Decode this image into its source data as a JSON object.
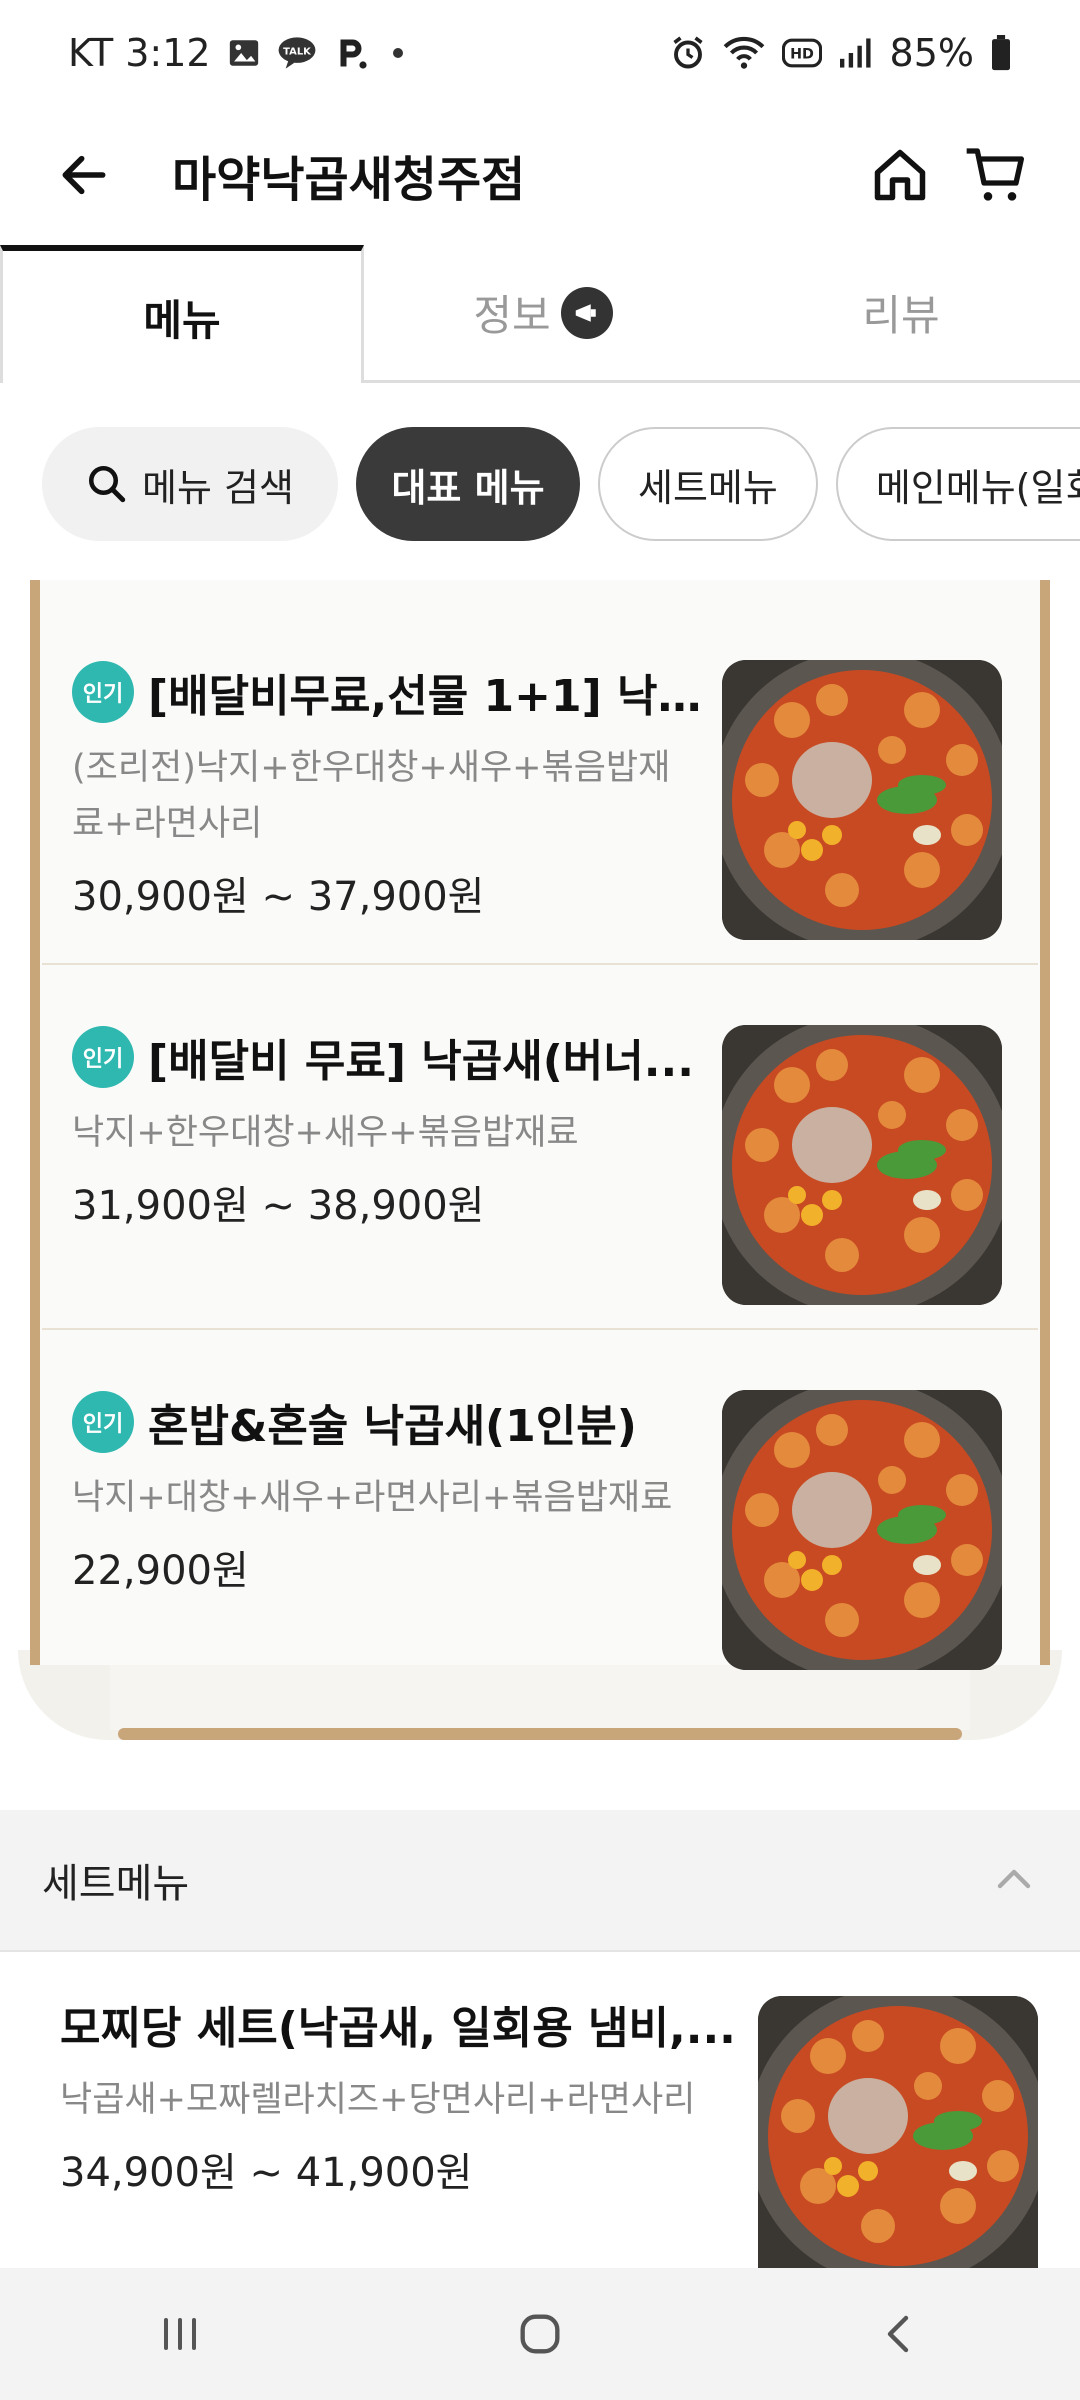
{
  "status_bar": {
    "carrier_time": "KT 3:12",
    "battery": "85%"
  },
  "header": {
    "title": "마약낙곱새청주점"
  },
  "tabs": [
    {
      "label": "메뉴"
    },
    {
      "label": "정보"
    },
    {
      "label": "리뷰"
    }
  ],
  "chips": {
    "search_label": "메뉴 검색",
    "items": [
      "대표 메뉴",
      "세트메뉴",
      "메인메뉴(일회"
    ]
  },
  "featured": {
    "items": [
      {
        "badge": "인기",
        "name": "[배달비무료,선물 1+1] 낙...",
        "desc": "(조리전)낙지+한우대창+새우+볶음밥재료+라면사리",
        "price": "30,900원 ~ 37,900원"
      },
      {
        "badge": "인기",
        "name": "[배달비 무료] 낙곱새(버너...",
        "desc": "낙지+한우대창+새우+볶음밥재료",
        "price": "31,900원 ~ 38,900원"
      },
      {
        "badge": "인기",
        "name": "혼밥&혼술 낙곱새(1인분)",
        "desc": "낙지+대창+새우+라면사리+볶음밥재료",
        "price": "22,900원"
      }
    ]
  },
  "section": {
    "title": "세트메뉴",
    "items": [
      {
        "name": "모찌당 세트(낙곱새, 일회용 냄비,...",
        "desc": "낙곱새+모짜렐라치즈+당면사리+라면사리",
        "price": "34,900원 ~ 41,900원"
      }
    ]
  }
}
